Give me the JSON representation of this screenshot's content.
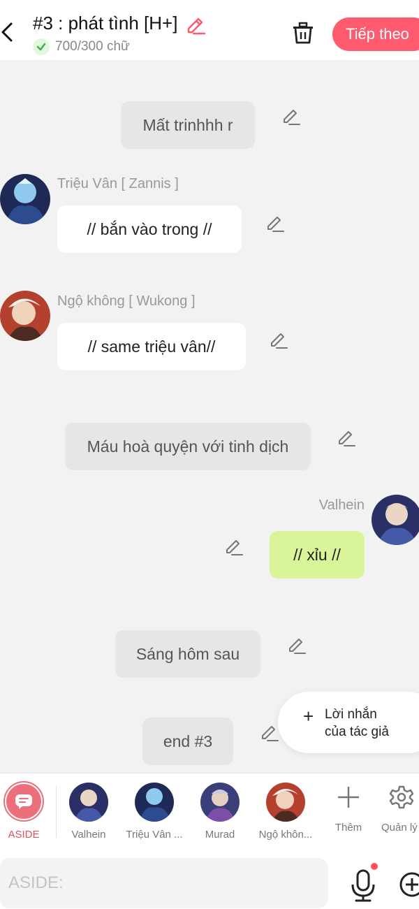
{
  "header": {
    "title": "#3 : phát tình [H+]",
    "word_count": "700/300 chữ",
    "next_label": "Tiếp theo"
  },
  "messages": [
    {
      "type": "narration",
      "text": "Mất trinhhh r"
    },
    {
      "type": "chat",
      "speaker": "Triệu Vân [ Zannis ]",
      "text": "// bắn vào trong //"
    },
    {
      "type": "chat",
      "speaker": "Ngộ không [ Wukong ]",
      "text": "// same triệu vân//"
    },
    {
      "type": "narration",
      "text": "Máu hoà quyện với tinh dịch"
    },
    {
      "type": "chat_self",
      "speaker": "Valhein",
      "text": "// xỉu //"
    },
    {
      "type": "narration",
      "text": "Sáng hôm sau"
    },
    {
      "type": "narration",
      "text": "end #3"
    }
  ],
  "author_note": {
    "line1": "Lời nhắn",
    "line2": "của tác giả"
  },
  "characters": {
    "aside": "ASIDE",
    "list": [
      "Valhein",
      "Triệu Vân ...",
      "Murad",
      "Ngộ khôn..."
    ],
    "add": "Thêm",
    "manage": "Quản lý"
  },
  "input": {
    "placeholder": "ASIDE:"
  },
  "colors": {
    "accent": "#ff5a6e",
    "self_bubble": "#d9f499",
    "narration_bubble": "#e6e6e6",
    "background": "#f2f2f2"
  },
  "icons": [
    "back-icon",
    "pencil-icon",
    "check-icon",
    "trash-icon",
    "plus-icon",
    "gear-icon",
    "mic-icon",
    "plus-circle-icon",
    "chat-bubble-icon"
  ]
}
